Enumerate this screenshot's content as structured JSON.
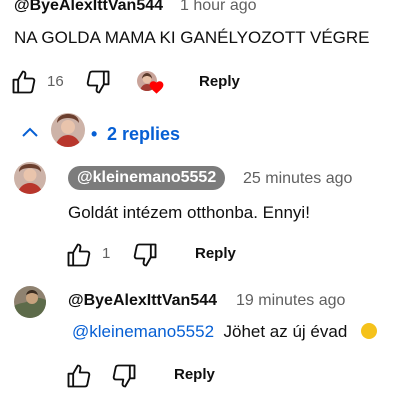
{
  "comment": {
    "author": "@ByeAlexIttVan544",
    "time": "1 hour ago",
    "text": "NA GOLDA MAMA KI GANÉLYOZOTT VÉGRE",
    "likes": "16",
    "reply_label": "Reply",
    "hearted": true
  },
  "replies_toggle": {
    "label": "2 replies",
    "expanded": true,
    "accent_color": "#065fd4"
  },
  "replies": [
    {
      "author": "@kleinemano5552",
      "author_highlighted": true,
      "time": "25 minutes ago",
      "text": "Goldát intézem otthonba. Ennyi!",
      "likes": "1",
      "reply_label": "Reply"
    },
    {
      "author": "@ByeAlexIttVan544",
      "time": "19 minutes ago",
      "mention": "@kleinemano5552",
      "text": "Jöhet az új évad",
      "reply_label": "Reply"
    }
  ],
  "colors": {
    "text": "#0f0f0f",
    "secondary": "#606060",
    "link": "#065fd4",
    "heart": "#ff0000",
    "creator_pill": "#7c7c7c"
  }
}
